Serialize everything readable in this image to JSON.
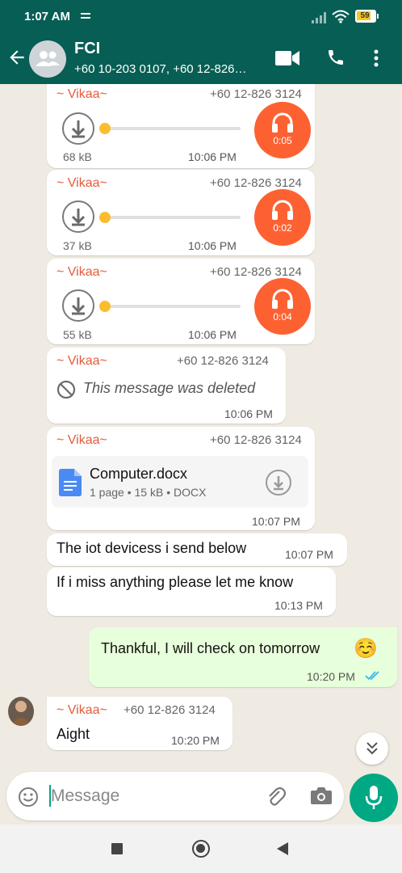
{
  "status_bar": {
    "time": "1:07 AM",
    "battery": "59",
    "icons": [
      "sim-icon",
      "signal-icon",
      "wifi-icon",
      "battery-icon"
    ]
  },
  "header": {
    "title": "FCI",
    "subtitle": "+60 10-203 0107, +60 12-826…",
    "icons": [
      "back-arrow-icon",
      "group-avatar-icon",
      "video-call-icon",
      "voice-call-icon",
      "more-vert-icon"
    ]
  },
  "messages": [
    {
      "type": "audio",
      "sender": "~ Vikaa~",
      "phone": "+60 12-826 3124",
      "size": "68 kB",
      "time": "10:06 PM",
      "duration": "0:05"
    },
    {
      "type": "audio",
      "sender": "~ Vikaa~",
      "phone": "+60 12-826 3124",
      "size": "37 kB",
      "time": "10:06 PM",
      "duration": "0:02"
    },
    {
      "type": "audio",
      "sender": "~ Vikaa~",
      "phone": "+60 12-826 3124",
      "size": "55 kB",
      "time": "10:06 PM",
      "duration": "0:04"
    },
    {
      "type": "deleted",
      "sender": "~ Vikaa~",
      "phone": "+60 12-826 3124",
      "text": "This message was deleted",
      "time": "10:06 PM"
    },
    {
      "type": "document",
      "sender": "~ Vikaa~",
      "phone": "+60 12-826 3124",
      "filename": "Computer.docx",
      "details": "1 page • 15 kB • DOCX",
      "time": "10:07 PM"
    },
    {
      "type": "text",
      "text": "The iot devicess i send below",
      "time": "10:07 PM"
    },
    {
      "type": "text",
      "text": "If i miss anything please let me know",
      "time": "10:13 PM"
    },
    {
      "type": "outgoing",
      "text": "Thankful, I will check on tomorrow",
      "emoji": "☺️",
      "time": "10:20 PM",
      "status": "read"
    },
    {
      "type": "text",
      "sender": "~ Vikaa~",
      "phone": "+60 12-826 3124",
      "text": "Aight",
      "time": "10:20 PM"
    }
  ],
  "composer": {
    "placeholder": "Message",
    "icons": [
      "emoji-icon",
      "attach-icon",
      "camera-icon",
      "mic-icon"
    ]
  },
  "colors": {
    "header": "#075e54",
    "sender": "#e45b3b",
    "audio_badge": "#fd6132",
    "accent": "#00a884",
    "outgoing_bubble": "#e7ffdb"
  }
}
